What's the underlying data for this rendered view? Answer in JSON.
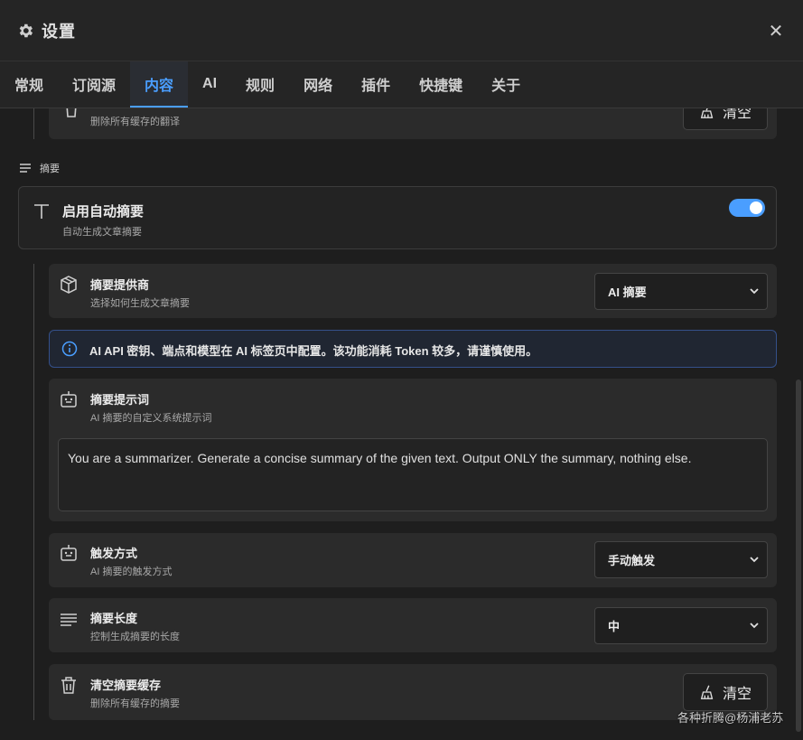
{
  "window": {
    "title": "设置",
    "icon": "gear-icon",
    "close_icon": "close-icon",
    "close_glyph": "✕"
  },
  "tabs": [
    {
      "label": "常规",
      "active": false
    },
    {
      "label": "订阅源",
      "active": false
    },
    {
      "label": "内容",
      "active": true
    },
    {
      "label": "AI",
      "active": false
    },
    {
      "label": "规则",
      "active": false
    },
    {
      "label": "网络",
      "active": false
    },
    {
      "label": "插件",
      "active": false
    },
    {
      "label": "快捷键",
      "active": false
    },
    {
      "label": "关于",
      "active": false
    }
  ],
  "translation_cache": {
    "subtitle": "删除所有缓存的翻译",
    "button_label": "清空",
    "button_icon": "broom-icon"
  },
  "summary_section": {
    "heading": "摘要",
    "heading_icon": "lines-icon"
  },
  "enable_summary": {
    "icon": "text-t-icon",
    "title": "启用自动摘要",
    "subtitle": "自动生成文章摘要",
    "enabled": true
  },
  "provider": {
    "icon": "box-icon",
    "title": "摘要提供商",
    "subtitle": "选择如何生成文章摘要",
    "selected": "AI 摘要"
  },
  "info_banner": {
    "icon": "info-icon",
    "text": "AI API 密钥、端点和模型在 AI 标签页中配置。该功能消耗 Token 较多，请谨慎使用。"
  },
  "prompt": {
    "icon": "robot-icon",
    "title": "摘要提示词",
    "subtitle": "AI 摘要的自定义系统提示词",
    "value": "You are a summarizer. Generate a concise summary of the given text. Output ONLY the summary, nothing else."
  },
  "trigger": {
    "icon": "robot-icon",
    "title": "触发方式",
    "subtitle": "AI 摘要的触发方式",
    "selected": "手动触发"
  },
  "length": {
    "icon": "lines-icon",
    "title": "摘要长度",
    "subtitle": "控制生成摘要的长度",
    "selected": "中"
  },
  "clear_summary_cache": {
    "icon": "trash-icon",
    "title": "清空摘要缓存",
    "subtitle": "删除所有缓存的摘要",
    "button_label": "清空",
    "button_icon": "broom-icon"
  },
  "watermark": "各种折腾@杨浦老苏",
  "colors": {
    "accent": "#4a9eff",
    "background": "#1e1e1e",
    "card": "#2b2b2b"
  }
}
